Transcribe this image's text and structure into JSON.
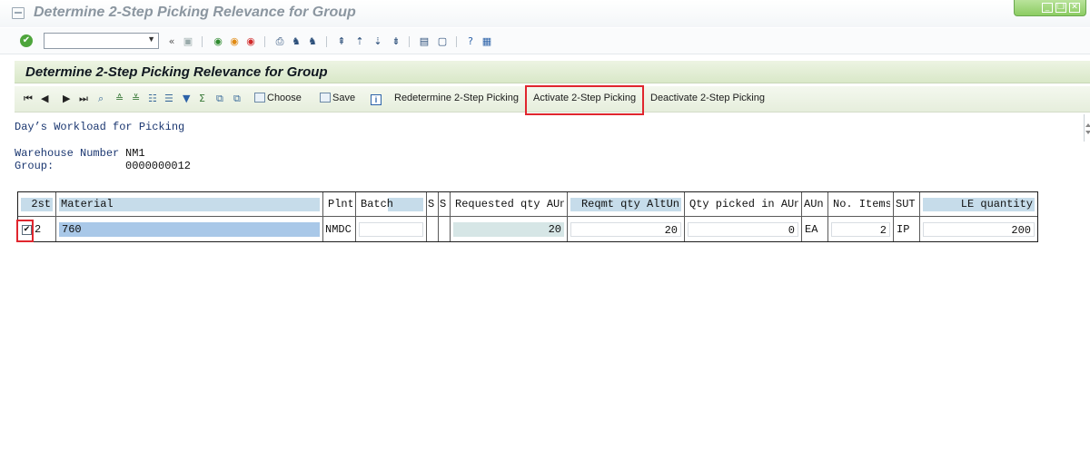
{
  "window": {
    "title": "Determine 2-Step Picking Relevance for Group"
  },
  "system_toolbar": {
    "command_field_value": "",
    "icons": [
      "enter-icon",
      "back-icon",
      "save-icon",
      "back-nav-icon",
      "exit-icon",
      "cancel-icon",
      "print-icon",
      "find-icon",
      "find-next-icon",
      "first-page-icon",
      "previous-page-icon",
      "next-page-icon",
      "last-page-icon",
      "new-session-icon",
      "shortcut-icon",
      "help-icon",
      "customize-layout-icon"
    ],
    "chevron": "«"
  },
  "app": {
    "title": "Determine 2-Step Picking Relevance for Group",
    "toolbar": {
      "choose_label": "Choose",
      "save_label": "Save",
      "redetermine_label": "Redetermine 2-Step Picking",
      "activate_label": "Activate 2-Step Picking",
      "deactivate_label": "Deactivate 2-Step Picking"
    }
  },
  "content": {
    "heading": "Day’s Workload for Picking",
    "warehouse_label": "Warehouse Number",
    "warehouse_value": "NM1",
    "group_label": "Group:",
    "group_value": "0000000012"
  },
  "table": {
    "columns": [
      "2st",
      "Material",
      "Plnt",
      "Batch",
      "S",
      "S",
      "Requested qty AUn",
      "Reqmt qty AltUn",
      "Qty picked in AUn",
      "AUn",
      "No. Items",
      "SUT",
      "LE quantity"
    ],
    "rows": [
      {
        "checked": true,
        "twostep": "2",
        "material": "760",
        "plant": "NMDC",
        "batch": "",
        "s1": "",
        "s2": "",
        "requested_qty": "20",
        "reqmt_qty": "20",
        "qty_picked": "0",
        "aun": "EA",
        "no_items": "2",
        "sut": "IP",
        "le_quantity": "200"
      }
    ]
  },
  "colors": {
    "title_bg": "#e6f0dc",
    "header_cell": "#c6dcea",
    "highlight": "#e0262e",
    "material_cell": "#a9c8e8"
  }
}
